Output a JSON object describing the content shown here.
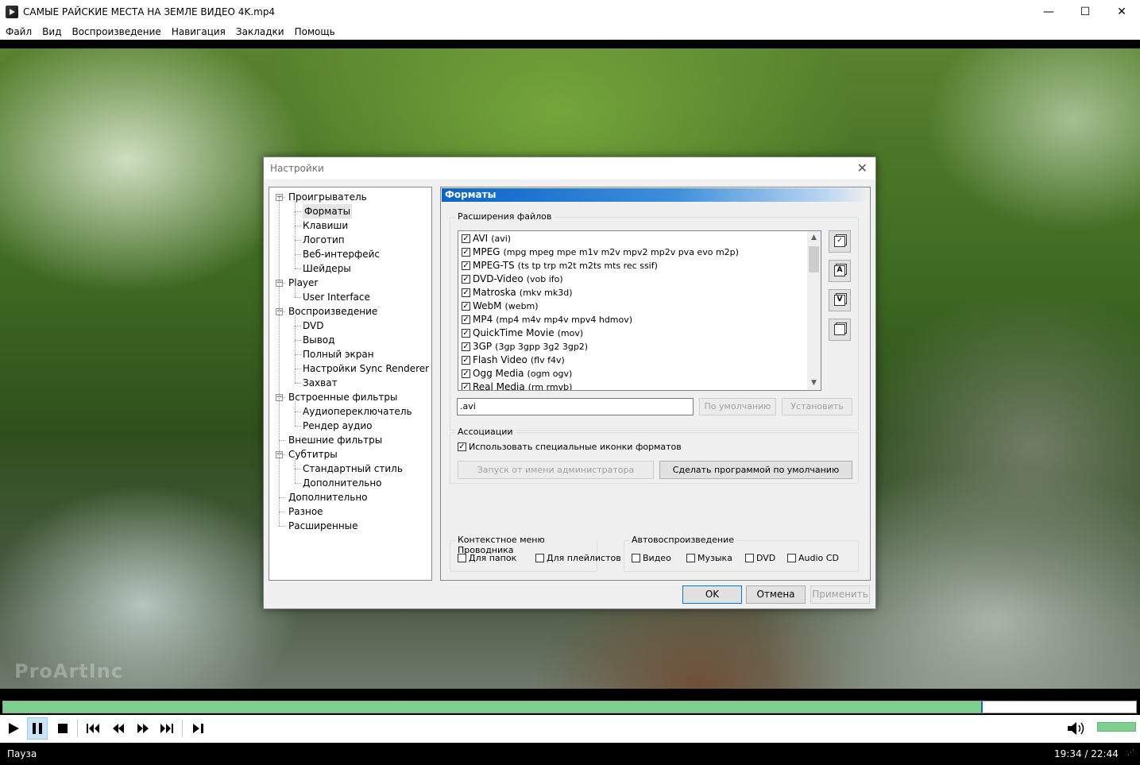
{
  "window": {
    "title": "САМЫЕ РАЙСКИЕ МЕСТА НА ЗЕМЛЕ ВИДЕО 4K.mp4",
    "min_glyph": "—",
    "max_glyph": "☐",
    "close_glyph": "✕"
  },
  "menu": [
    "Файл",
    "Вид",
    "Воспроизведение",
    "Навигация",
    "Закладки",
    "Помощь"
  ],
  "video": {
    "watermark": "ProArtInc"
  },
  "dialog": {
    "title": "Настройки",
    "close_glyph": "✕",
    "tree": [
      {
        "label": "Проигрыватель",
        "level": 0,
        "expander": "−"
      },
      {
        "label": "Форматы",
        "level": 1,
        "selected": true
      },
      {
        "label": "Клавиши",
        "level": 1
      },
      {
        "label": "Логотип",
        "level": 1
      },
      {
        "label": "Веб-интерфейс",
        "level": 1
      },
      {
        "label": "Шейдеры",
        "level": 1
      },
      {
        "label": "Player",
        "level": 0,
        "expander": "−"
      },
      {
        "label": "User Interface",
        "level": 1
      },
      {
        "label": "Воспроизведение",
        "level": 0,
        "expander": "−"
      },
      {
        "label": "DVD",
        "level": 1
      },
      {
        "label": "Вывод",
        "level": 1
      },
      {
        "label": "Полный экран",
        "level": 1
      },
      {
        "label": "Настройки Sync Renderer",
        "level": 1
      },
      {
        "label": "Захват",
        "level": 1
      },
      {
        "label": "Встроенные фильтры",
        "level": 0,
        "expander": "−"
      },
      {
        "label": "Аудиопереключатель",
        "level": 1
      },
      {
        "label": "Рендер аудио",
        "level": 1
      },
      {
        "label": "Внешние фильтры",
        "level": 0
      },
      {
        "label": "Субтитры",
        "level": 0,
        "expander": "−"
      },
      {
        "label": "Стандартный стиль",
        "level": 1
      },
      {
        "label": "Дополнительно",
        "level": 1
      },
      {
        "label": "Дополнительно",
        "level": 0
      },
      {
        "label": "Разное",
        "level": 0
      },
      {
        "label": "Расширенные",
        "level": 0
      }
    ],
    "panel_title": "Форматы",
    "extensions_group": "Расширения файлов",
    "formats": [
      {
        "name": "AVI",
        "ext": "(avi)",
        "checked": true
      },
      {
        "name": "MPEG",
        "ext": "(mpg mpeg mpe m1v m2v mpv2 mp2v pva evo m2p)",
        "checked": true
      },
      {
        "name": "MPEG-TS",
        "ext": "(ts tp trp m2t m2ts mts rec ssif)",
        "checked": true
      },
      {
        "name": "DVD-Video",
        "ext": "(vob ifo)",
        "checked": true
      },
      {
        "name": "Matroska",
        "ext": "(mkv mk3d)",
        "checked": true
      },
      {
        "name": "WebM",
        "ext": "(webm)",
        "checked": true
      },
      {
        "name": "MP4",
        "ext": "(mp4 m4v mp4v mpv4 hdmov)",
        "checked": true
      },
      {
        "name": "QuickTime Movie",
        "ext": "(mov)",
        "checked": true
      },
      {
        "name": "3GP",
        "ext": "(3gp 3gpp 3g2 3gp2)",
        "checked": true
      },
      {
        "name": "Flash Video",
        "ext": "(flv f4v)",
        "checked": true
      },
      {
        "name": "Ogg Media",
        "ext": "(ogm ogv)",
        "checked": true
      },
      {
        "name": "Real Media",
        "ext": "(rm rmvb)",
        "checked": true
      }
    ],
    "side_buttons": [
      "✓",
      "A",
      "V",
      ""
    ],
    "ext_value": ".avi",
    "btn_default": "По умолчанию",
    "btn_set": "Установить",
    "assoc_group": "Ассоциации",
    "assoc_checkbox": "Использовать специальные иконки форматов",
    "assoc_checked": true,
    "btn_admin": "Запуск от имени администратора",
    "btn_make_default": "Сделать программой по умолчанию",
    "ctx_group": "Контекстное меню Проводника",
    "ctx_folders": "Для папок",
    "ctx_playlists": "Для плейлистов",
    "autoplay_group": "Автовоспроизведение",
    "autoplay": [
      "Видео",
      "Музыка",
      "DVD",
      "Audio CD"
    ],
    "ok": "OK",
    "cancel": "Отмена",
    "apply": "Применить"
  },
  "player": {
    "progress": 0.863,
    "volume": 1.0,
    "status": "Пауза",
    "time": "19:34 / 22:44"
  },
  "colors": {
    "seek_fill": "#7ed091",
    "accent": "#0078d7",
    "panel_header": "#0a64c8"
  }
}
